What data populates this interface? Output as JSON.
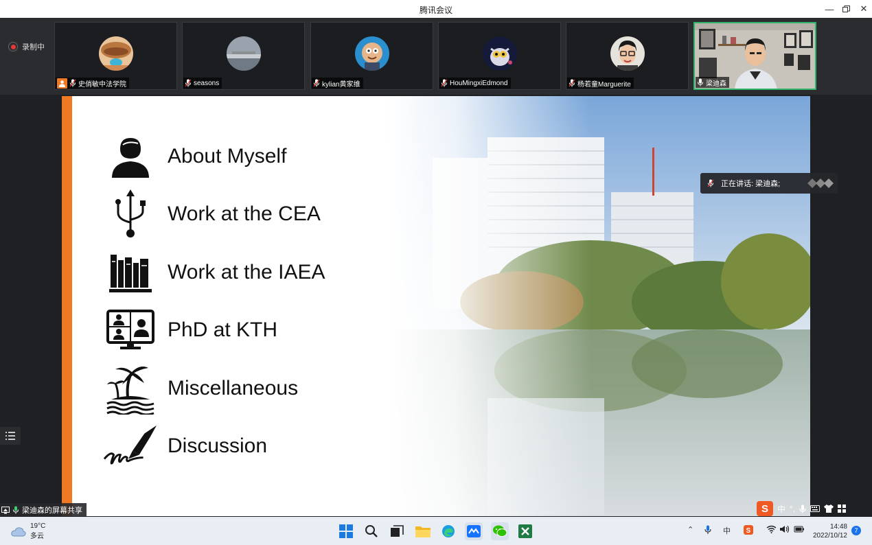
{
  "window": {
    "title": "腾讯会议"
  },
  "recording": {
    "label": "录制中"
  },
  "participants": [
    {
      "name": "史俏敏中法学院"
    },
    {
      "name": "seasons"
    },
    {
      "name": "kylian黄家维"
    },
    {
      "name": "HouMingxiEdmond"
    },
    {
      "name": "杨若童Marguerite"
    },
    {
      "name": "梁迪森"
    }
  ],
  "slide": {
    "items": [
      {
        "label": "About Myself",
        "icon": "person-icon"
      },
      {
        "label": "Work at the CEA",
        "icon": "usb-icon"
      },
      {
        "label": "Work at the IAEA",
        "icon": "library-icon"
      },
      {
        "label": "PhD at KTH",
        "icon": "video-conference-icon"
      },
      {
        "label": "Miscellaneous",
        "icon": "palm-island-icon"
      },
      {
        "label": "Discussion",
        "icon": "pen-signature-icon"
      }
    ],
    "accent": "#f07a23"
  },
  "speaking": {
    "label": "正在讲话: 梁迪森;"
  },
  "share_label": "梁迪森的屏幕共享",
  "ime": {
    "mode": "中",
    "punct": "°,"
  },
  "taskbar": {
    "weather": {
      "temp": "19°C",
      "desc": "多云"
    },
    "tray_text": "中",
    "time": "14:48",
    "date": "2022/10/12",
    "notifications": "7"
  }
}
